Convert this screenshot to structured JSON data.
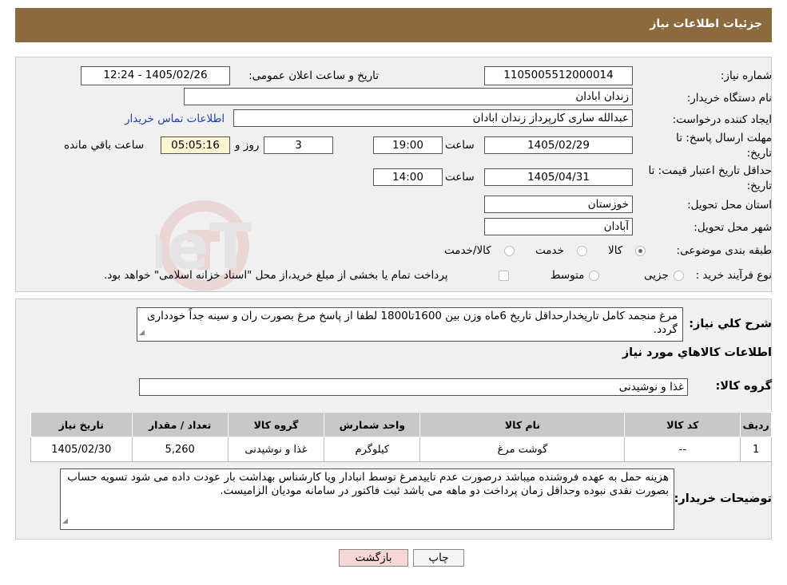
{
  "header": {
    "title": "جزئیات اطلاعات نیاز"
  },
  "form": {
    "need_number_label": "شماره نیاز:",
    "need_number": "1105005512000014",
    "announce_label": "تاریخ و ساعت اعلان عمومی:",
    "announce_value": "1405/02/26 - 12:24",
    "buyer_org_label": "نام دستگاه خریدار:",
    "buyer_org": "زندان ابادان",
    "requester_label": "ایجاد کننده درخواست:",
    "requester": "عبدالله ساری کارپرداز زندان ابادان",
    "contact_link": "اطلاعات تماس خریدار",
    "deadline_label_1": "مهلت ارسال پاسخ: تا",
    "deadline_label_2": "تاریخ:",
    "deadline_date": "1405/02/29",
    "time_label": "ساعت",
    "deadline_time": "19:00",
    "days_value": "3",
    "days_label": "روز و",
    "remaining_time": "05:05:16",
    "remaining_label": "ساعت باقي مانده",
    "validity_label_1": "حداقل تاریخ اعتبار قیمت: تا",
    "validity_label_2": "تاریخ:",
    "validity_date": "1405/04/31",
    "validity_time": "14:00",
    "province_label": "استان محل تحویل:",
    "province": "خوزستان",
    "city_label": "شهر محل تحویل:",
    "city": "آبادان",
    "category_label": "طبقه بندی موضوعی:",
    "category_options": [
      "کالا",
      "خدمت",
      "کالا/خدمت"
    ],
    "process_label": "نوع فرآیند خرید :",
    "process_options": [
      "جزیی",
      "متوسط"
    ],
    "process_note": "پرداخت تمام یا بخشی از مبلغ خرید،از محل \"اسناد خزانه اسلامی\" خواهد بود."
  },
  "details": {
    "description_label": "شرح کلي نياز:",
    "description": "مرغ منجمد کامل تاریخدارحداقل تاریخ 6ماه وزن بین 1600تا1800 لطفا از پاسخ مرغ بصورت ران و سینه جداً خودداری گردد.",
    "goods_info_title": "اطلاعات کالاهاي مورد نياز",
    "goods_group_label": "گروه کالا:",
    "goods_group": "غذا و نوشیدنی",
    "table": {
      "headers": [
        "ردیف",
        "کد کالا",
        "نام کالا",
        "واحد شمارش",
        "گروه کالا",
        "تعداد / مقدار",
        "تاریخ نیاز"
      ],
      "rows": [
        [
          "1",
          "--",
          "گوشت مرغ",
          "کیلوگرم",
          "غذا و نوشیدنی",
          "5,260",
          "1405/02/30"
        ]
      ]
    },
    "buyer_notes_label": "توضیحات خریدار:",
    "buyer_notes": "هزینه حمل به عهده فروشنده میباشد درصورت عدم تاییدمرغ توسط انبادار ویا کارشناس بهداشت بار عودت داده می شود تسویه حساب بصورت نقدی نبوده وحداقل زمان پرداخت دو ماهه می باشد ثبت فاکتور  در سامانه مودیان الزامیست."
  },
  "buttons": {
    "print": "چاپ",
    "back": "بازگشت"
  },
  "colors": {
    "header_bg": "#8b6a3e",
    "link": "#1f3ea8",
    "back_btn_bg": "#f6d6d6"
  }
}
